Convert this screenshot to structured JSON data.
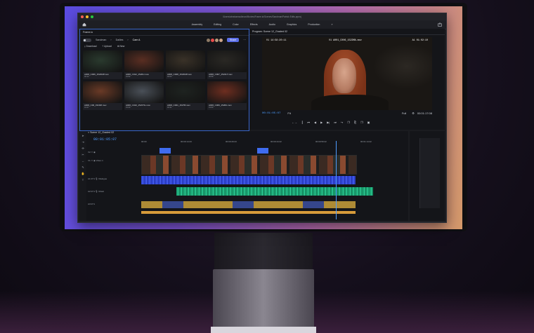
{
  "window": {
    "title_path": "/Users/abrahamsoliman/Movies/Frame.io/Scenes/Sandman/Patrick Edits.prproj"
  },
  "menu": [
    "Assembly",
    "Editing",
    "Color",
    "Effects",
    "Audio",
    "Graphics",
    "Production",
    "»"
  ],
  "frameio": {
    "tab": "Frame.io",
    "breadcrumbs": [
      "Sandman",
      "Dailies",
      "Cam A"
    ],
    "share_label": "Share",
    "actions": [
      "Download",
      "Upload",
      "New"
    ],
    "assets": [
      {
        "name": "A006_C006_1523MP.mov",
        "meta": "02:14",
        "thumb": "#2a3a2e"
      },
      {
        "name": "A006_C012_1520U.mov",
        "meta": "01:52",
        "thumb": "#5a2e22"
      },
      {
        "name": "A006_C008_1523MP.mov",
        "meta": "02:03",
        "thumb": "#3a3228"
      },
      {
        "name": "A006_C007_1524LT.mov",
        "meta": "00:58",
        "thumb": "#2a2824"
      },
      {
        "name": "A006_C00_1523M.mov",
        "meta": "01:27",
        "thumb": "#6a3a26"
      },
      {
        "name": "A006_C010_1523TG.mov",
        "meta": "01:44",
        "thumb": "#4a5058"
      },
      {
        "name": "A006_C001_1527B.mov",
        "meta": "02:21",
        "thumb": "#1e2320"
      },
      {
        "name": "A006_C006_1528A.mov",
        "meta": "01:09",
        "thumb": "#6e2e20"
      }
    ]
  },
  "program": {
    "tab": "Program: Scene 12_Graded 02",
    "burnin_left": "V1 14:58:20:11",
    "burnin_mid": "V1 A001_C006_1523MA.mov",
    "burnin_right": "A1 01:02:10",
    "timecode": "00:01:05:07",
    "fit": "Fit",
    "quality": "Full",
    "duration": "00:01:17:08",
    "transport": [
      "←→",
      "┃",
      "⏮",
      "◀",
      "▶",
      "▶|",
      "⏭",
      "↪",
      "❐",
      "⎘",
      "❐",
      "▣"
    ]
  },
  "timeline": {
    "tab": "Scene 12_Graded 02",
    "timecode": "00:01:05:07",
    "ruler": [
      "00:00",
      "00:00:14:23",
      "00:00:29:23",
      "00:00:44:22",
      "00:00:59:22",
      "00:01:14:22"
    ],
    "tracks": [
      "V2",
      "V1",
      "Video 1",
      "A1",
      "Dialogue",
      "A2",
      "Music",
      "A3"
    ]
  },
  "colors": {
    "accent": "#4e9cff",
    "share": "#5b6ee8",
    "dialogue": "#3147d8",
    "music": "#21b27a",
    "sfx": "#c9a03a"
  }
}
